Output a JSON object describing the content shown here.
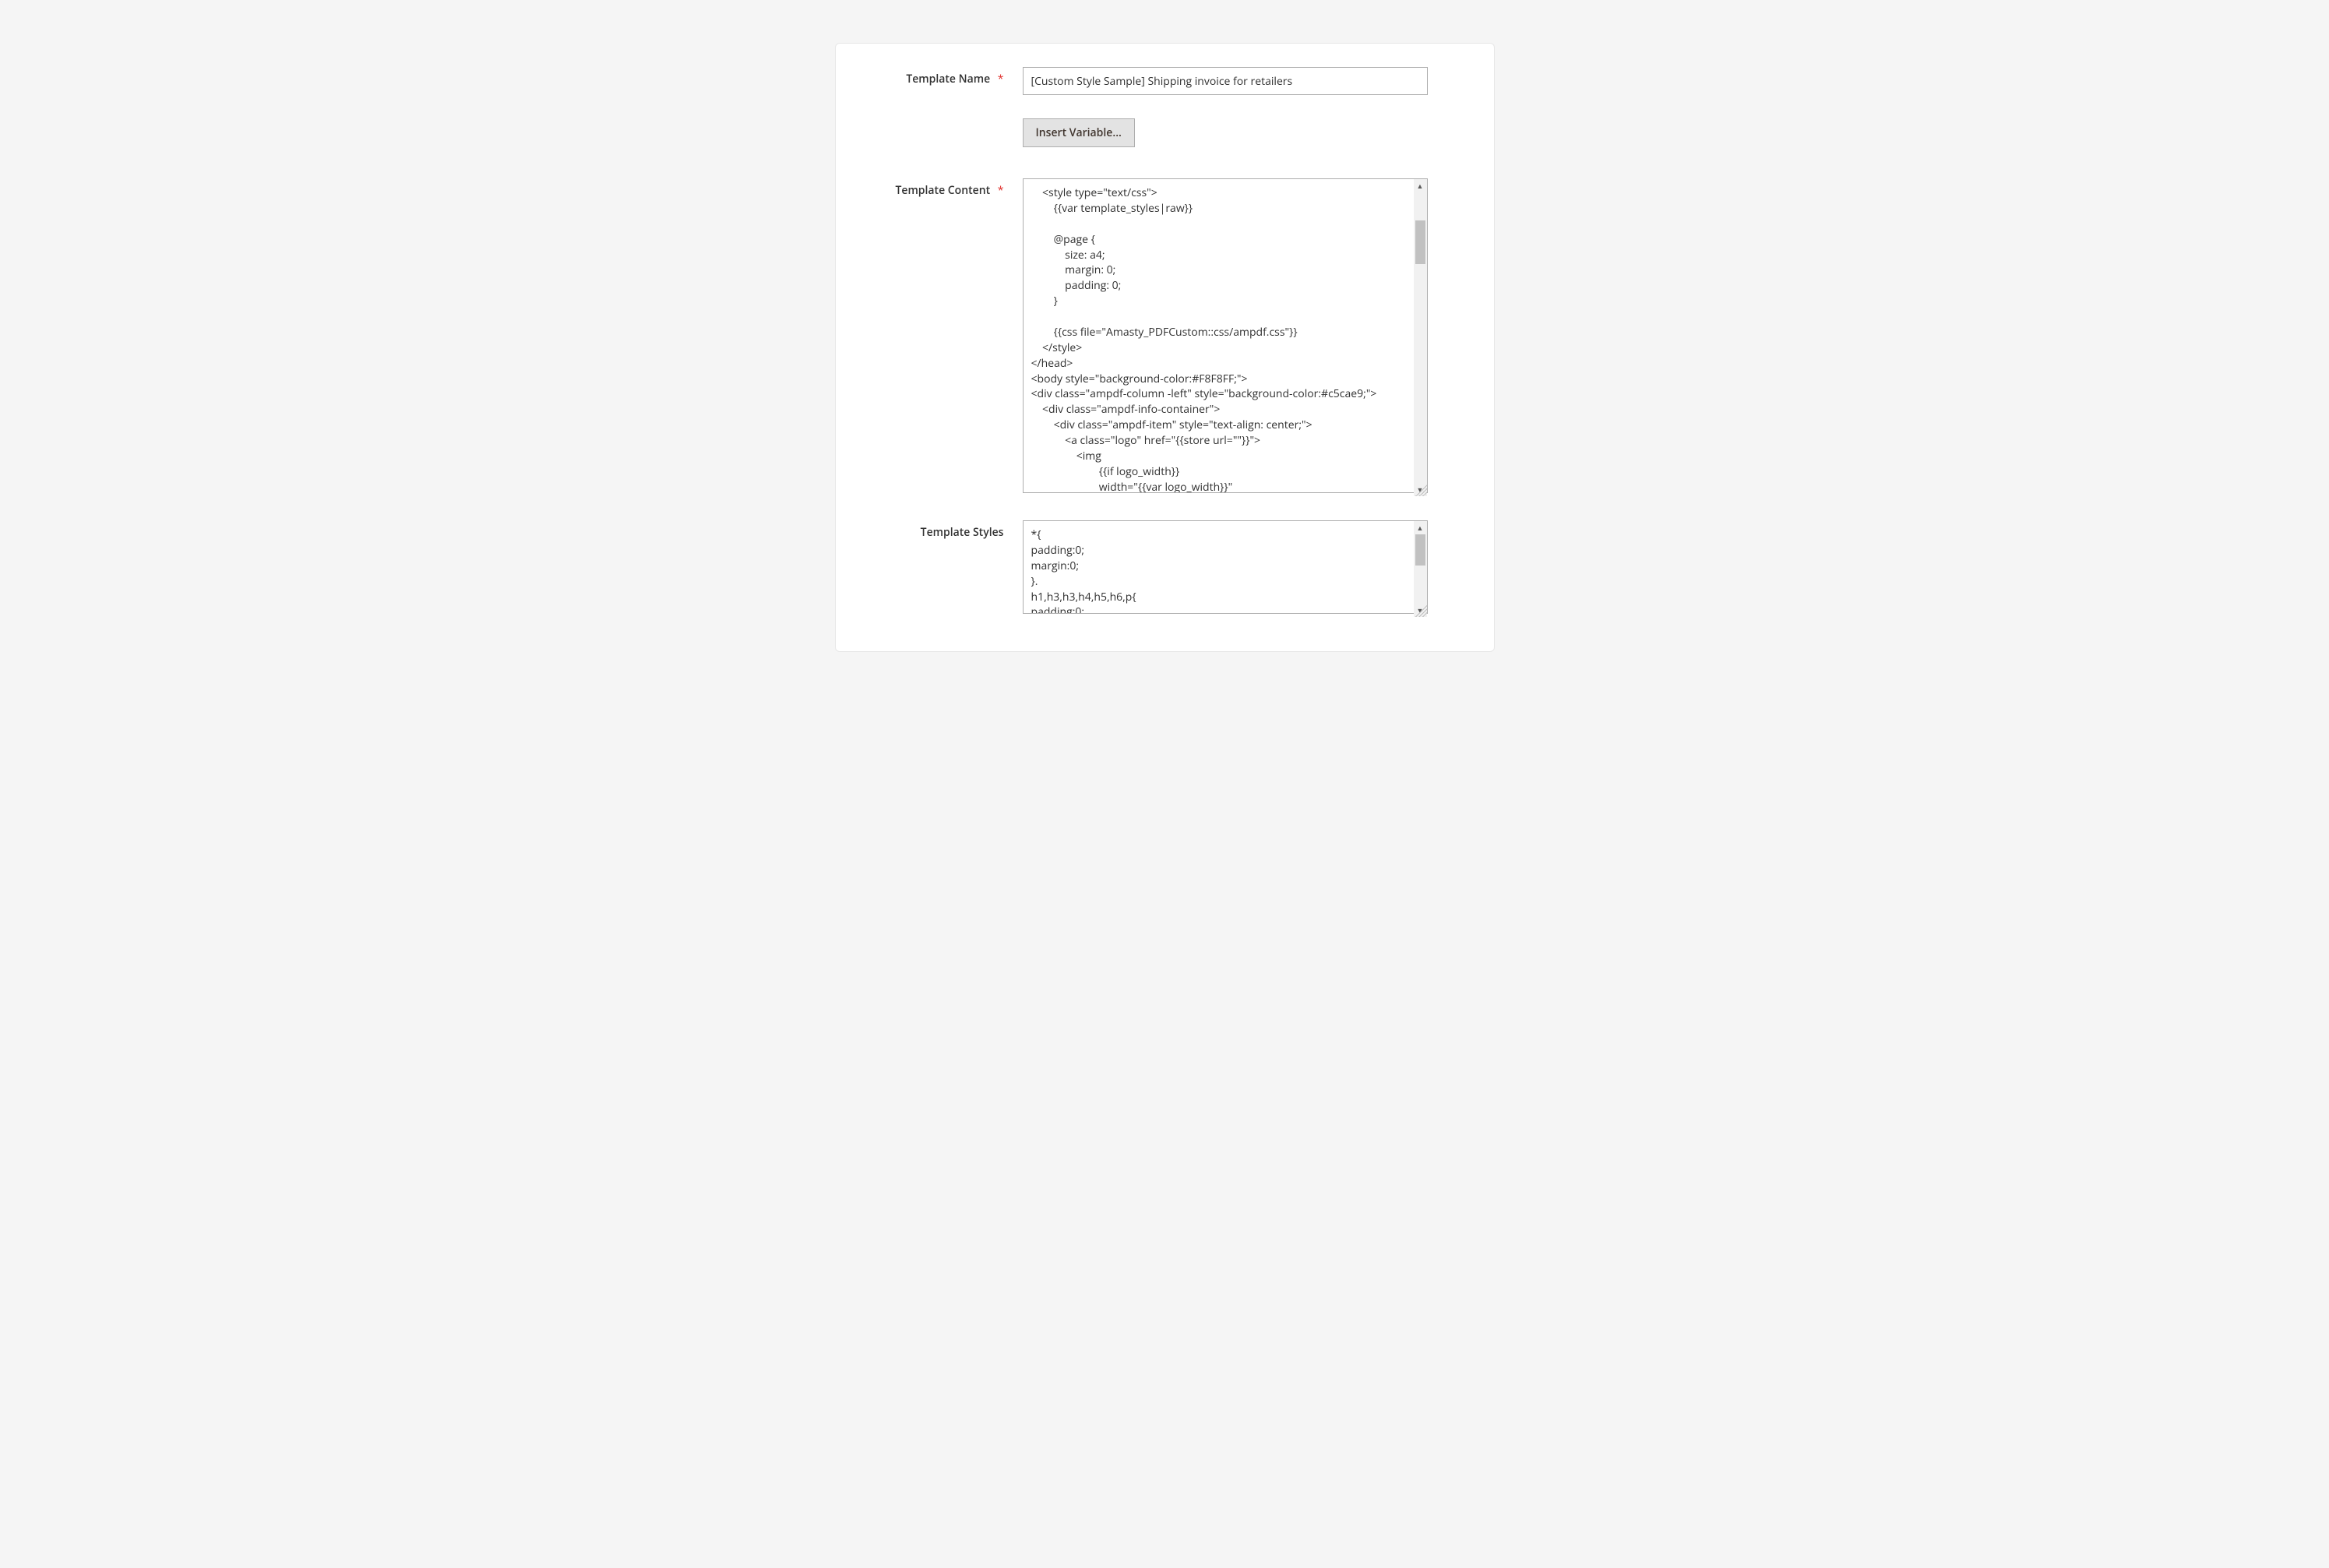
{
  "fields": {
    "template_name": {
      "label": "Template Name",
      "required": true,
      "value": "[Custom Style Sample] Shipping invoice for retailers"
    },
    "template_content": {
      "label": "Template Content",
      "required": true,
      "value": "    <style type=\"text/css\">\n        {{var template_styles|raw}}\n\n        @page {\n            size: a4;\n            margin: 0;\n            padding: 0;\n        }\n\n        {{css file=\"Amasty_PDFCustom::css/ampdf.css\"}}\n    </style>\n</head>\n<body style=\"background-color:#F8F8FF;\">\n<div class=\"ampdf-column -left\" style=\"background-color:#c5cae9;\">\n    <div class=\"ampdf-info-container\">\n        <div class=\"ampdf-item\" style=\"text-align: center;\">\n            <a class=\"logo\" href=\"{{store url=\"\"}}\">\n                <img\n                        {{if logo_width}}\n                        width=\"{{var logo_width}}\""
    },
    "template_styles": {
      "label": "Template Styles",
      "required": false,
      "value": "*{\npadding:0;\nmargin:0;\n}.\nh1,h3,h3,h4,h5,h6,p{\npadding:0;"
    }
  },
  "buttons": {
    "insert_variable": "Insert Variable..."
  },
  "required_marker": "*"
}
